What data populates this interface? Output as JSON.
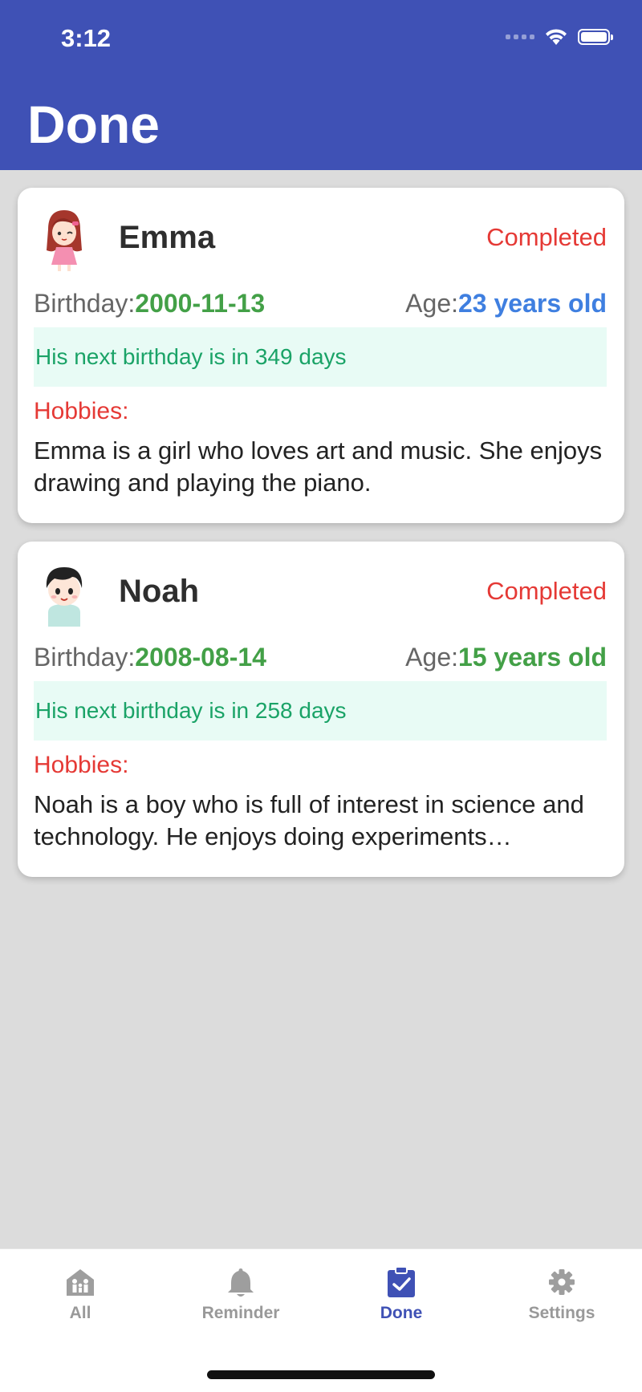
{
  "status_bar": {
    "time": "3:12"
  },
  "header": {
    "title": "Done"
  },
  "cards": [
    {
      "name": "Emma",
      "status": "Completed",
      "birthday_label": "Birthday:",
      "birthday": "2000-11-13",
      "age_label": "Age:",
      "age": "23 years old",
      "next_birthday": "His next birthday is in 349 days",
      "hobbies_label": "Hobbies:",
      "hobbies": "Emma is a girl who loves art and music. She enjoys drawing and playing the piano."
    },
    {
      "name": "Noah",
      "status": "Completed",
      "birthday_label": "Birthday:",
      "birthday": "2008-08-14",
      "age_label": "Age:",
      "age": "15 years old",
      "next_birthday": "His next birthday is in 258 days",
      "hobbies_label": "Hobbies:",
      "hobbies": "Noah is a boy who is full of interest in science and technology. He enjoys doing experiments…"
    }
  ],
  "tabs": [
    {
      "label": "All",
      "icon": "home-family-icon"
    },
    {
      "label": "Reminder",
      "icon": "bell-icon"
    },
    {
      "label": "Done",
      "icon": "clipboard-check-icon",
      "active": true
    },
    {
      "label": "Settings",
      "icon": "gear-icon"
    }
  ],
  "colors": {
    "primary": "#3f51b5",
    "accent_red": "#e53935",
    "green": "#43a047",
    "blue": "#3f7fe0"
  }
}
